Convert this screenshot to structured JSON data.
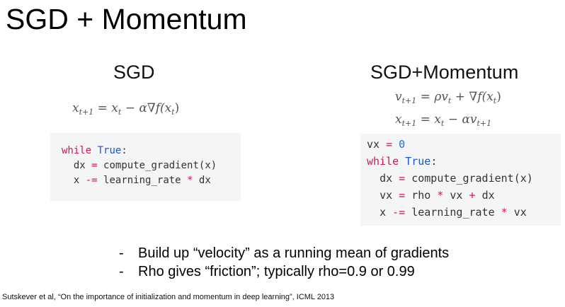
{
  "title": "SGD + Momentum",
  "sgd": {
    "heading": "SGD",
    "equation": {
      "lhs_var": "x",
      "lhs_sub": "t+1",
      "eq": "=",
      "r1_var": "x",
      "r1_sub": "t",
      "minus": "−",
      "alpha": "α",
      "nabla": "∇",
      "f": "f(x",
      "f_sub": "t",
      "close": ")"
    },
    "code": {
      "while_kw": "while",
      "true_kw": "True",
      "colon": ":",
      "l2_var": "dx",
      "l2_op": "=",
      "l2_rest": "compute_gradient(x)",
      "l3_var": "x",
      "l3_op": "-=",
      "l3_mid": "learning_rate",
      "l3_mul": "*",
      "l3_end": "dx"
    }
  },
  "momentum": {
    "heading": "SGD+Momentum",
    "eq1": {
      "lhs_var": "v",
      "lhs_sub": "t+1",
      "eq": "=",
      "rho": "ρ",
      "v": "v",
      "v_sub": "t",
      "plus": "+",
      "nabla": "∇",
      "f": "f(x",
      "f_sub": "t",
      "close": ")"
    },
    "eq2": {
      "lhs_var": "x",
      "lhs_sub": "t+1",
      "eq": "=",
      "r1_var": "x",
      "r1_sub": "t",
      "minus": "−",
      "alpha_v": "αv",
      "v_sub": "t+1"
    },
    "code": {
      "l1_var": "vx",
      "l1_op": "=",
      "l1_num": "0",
      "while_kw": "while",
      "true_kw": "True",
      "colon": ":",
      "l3_var": "dx",
      "l3_op": "=",
      "l3_rest": "compute_gradient(x)",
      "l4_var": "vx",
      "l4_op": "=",
      "l4_rho": "rho",
      "l4_mul": "*",
      "l4_vx": "vx",
      "l4_plus": "+",
      "l4_dx": "dx",
      "l5_var": "x",
      "l5_op": "-=",
      "l5_mid": "learning_rate",
      "l5_mul": "*",
      "l5_end": "vx"
    }
  },
  "bullets": [
    {
      "dash": "-",
      "text": "Build up “velocity” as a running mean of gradients"
    },
    {
      "dash": "-",
      "text": "Rho gives “friction”; typically rho=0.9 or 0.99"
    }
  ],
  "citation": "Sutskever et al, “On the importance of initialization and momentum in deep learning”, ICML 2013",
  "colors": {
    "keyword": "#d7174b",
    "builtin": "#1b58c2",
    "number": "#1b70c8",
    "code_bg": "#f4f5f6"
  }
}
